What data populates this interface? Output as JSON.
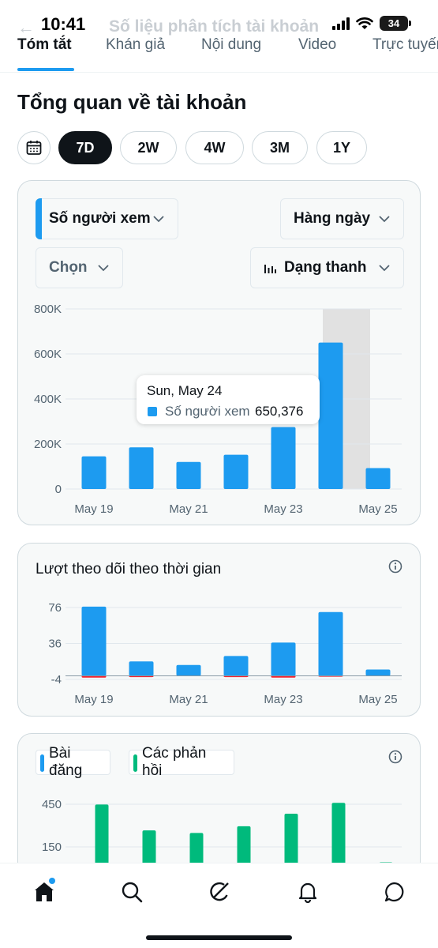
{
  "status_bar": {
    "time": "10:41",
    "battery": "34"
  },
  "header": {
    "title": "Số liệu phân tích tài khoản"
  },
  "tabs": [
    {
      "label": "Tóm tắt",
      "active": true
    },
    {
      "label": "Khán giả",
      "active": false
    },
    {
      "label": "Nội dung",
      "active": false
    },
    {
      "label": "Video",
      "active": false
    },
    {
      "label": "Trực tuyến",
      "active": false
    }
  ],
  "overview": {
    "title": "Tổng quan về tài khoản",
    "ranges": [
      "7D",
      "2W",
      "4W",
      "3M",
      "1Y"
    ],
    "active_range": "7D"
  },
  "viewers_card": {
    "metric_dropdown": "Số người xem",
    "interval_dropdown": "Hàng ngày",
    "compare_dropdown": "Chọn",
    "chart_type_dropdown": "Dạng thanh",
    "tooltip": {
      "date": "Sun, May 24",
      "series": "Số người xem",
      "value": "650,376"
    }
  },
  "followers_card": {
    "title": "Lượt theo dõi theo thời gian"
  },
  "posts_card": {
    "legend": [
      "Bài đăng",
      "Các phản hồi"
    ]
  },
  "colors": {
    "blue": "#1d9bf0",
    "green": "#00ba7c",
    "red": "#f4212e",
    "text": "#0f1419",
    "muted": "#536471"
  },
  "chart_data": [
    {
      "type": "bar",
      "categories": [
        "May 19",
        "May 20",
        "May 21",
        "May 22",
        "May 23",
        "May 24",
        "May 25"
      ],
      "x_tick_labels": [
        "May 19",
        "May 21",
        "May 23",
        "May 25"
      ],
      "y_tick_labels": [
        "800K",
        "600K",
        "400K",
        "200K",
        "0"
      ],
      "series": [
        {
          "name": "Số người xem",
          "values": [
            145000,
            185000,
            120000,
            152000,
            275000,
            650376,
            93000
          ]
        }
      ],
      "ylim": [
        0,
        800000
      ],
      "highlighted_category": "May 24",
      "grid": true
    },
    {
      "type": "bar",
      "categories": [
        "May 19",
        "May 20",
        "May 21",
        "May 22",
        "May 23",
        "May 24",
        "May 25"
      ],
      "x_tick_labels": [
        "May 19",
        "May 21",
        "May 23",
        "May 25"
      ],
      "y_tick_labels": [
        "76",
        "36",
        "-4"
      ],
      "series": [
        {
          "values": [
            77,
            16,
            12,
            22,
            37,
            71,
            7
          ]
        },
        {
          "values": [
            -2,
            -1.5,
            0,
            -1.5,
            -2,
            -1,
            0
          ]
        }
      ],
      "ylim": [
        -4,
        76
      ],
      "grid": true
    },
    {
      "type": "bar",
      "categories": [
        "May 19",
        "May 20",
        "May 21",
        "May 22",
        "May 23",
        "May 24",
        "May 25"
      ],
      "y_tick_labels": [
        "450",
        "150"
      ],
      "series": [
        {
          "name": "Bài đăng",
          "values": [
            0,
            0,
            0,
            0,
            0,
            0,
            0
          ]
        },
        {
          "name": "Các phản hồi",
          "values": [
            448,
            266,
            248,
            295,
            383,
            460,
            42
          ]
        }
      ],
      "grid": true
    }
  ],
  "bottom_nav": [
    "home-icon",
    "search-icon",
    "grok-icon",
    "notifications-icon",
    "messages-icon"
  ]
}
